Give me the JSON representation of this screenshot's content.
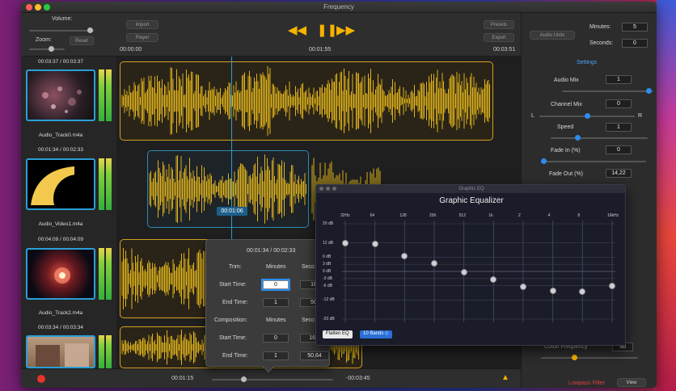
{
  "window": {
    "title": "Frequency"
  },
  "toolbar": {
    "volume_label": "Volume:",
    "zoom_label": "Zoom:",
    "reset_label": "Reset",
    "import_label": "Import",
    "player_label": "Player",
    "presets_label": "Presets",
    "export_label": "Export",
    "time_start": "00:00:00",
    "time_mid": "00:01:55",
    "time_end": "00:03:51",
    "rewind_glyph": "◀◀",
    "pause_glyph": "❚❚",
    "forward_glyph": "▶▶"
  },
  "right_panel": {
    "audio_units_label": "Audio Units",
    "minutes_label": "Minutes:",
    "minutes_value": "5",
    "seconds_label": "Seconds:",
    "seconds_value": "0",
    "settings_label": "Settings",
    "audio_mix_label": "Audio Mix",
    "audio_mix_value": "1",
    "channel_mix_label": "Channel Mix",
    "channel_mix_value": "0",
    "channel_left": "L",
    "channel_right": "R",
    "speed_label": "Speed",
    "speed_value": "1",
    "fade_in_label": "Fade In (%)",
    "fade_in_value": "0",
    "fade_out_label": "Fade Out (%)",
    "fade_out_value": "14,22",
    "cutoff_label": "Cutoff Frequency",
    "cutoff_value": "50",
    "lowpass_label": "Lowpass Filter",
    "view_label": "View"
  },
  "tracks": [
    {
      "time": "00:03:37 / 00:03:37",
      "name": "Audio_Track0.m4a"
    },
    {
      "time": "00:01:34 / 00:02:33",
      "name": "Audio_Video1.m4a"
    },
    {
      "time": "00:04:09 / 00:04:09",
      "name": "Audio_Track2.m4a"
    },
    {
      "time": "00:03:34 / 00:03:34",
      "name": ""
    }
  ],
  "timeline": {
    "playhead_time": "00:01:06"
  },
  "bottom": {
    "time_left": "00:01:15",
    "time_right": "-00:03:45",
    "warning_glyph": "▲"
  },
  "popover": {
    "header": "00:01:34 / 00:02:33",
    "trim_label": "Trim:",
    "minutes_col": "Minutes",
    "seconds_col": "Seco",
    "start_time_label": "Start Time:",
    "end_time_label": "End Time:",
    "trim_start_min": "0",
    "trim_start_sec": "16,",
    "trim_end_min": "1",
    "trim_end_sec": "50,",
    "composition_label": "Composition:",
    "minutes_col2": "Minutes",
    "seconds_col2": "Seco",
    "comp_start_min": "0",
    "comp_start_sec": "16,2",
    "comp_end_min": "1",
    "comp_end_sec": "50,64"
  },
  "equalizer": {
    "window_title": "Graphic EQ",
    "heading": "Graphic Equalizer",
    "frequencies": [
      "32Hz",
      "64",
      "128",
      "256",
      "512",
      "1k",
      "2",
      "4",
      "8",
      "16kHz"
    ],
    "db_labels": [
      "20 dB",
      "12 dB",
      "6 dB",
      "3 dB",
      "0 dB",
      "-3 dB",
      "-6 dB",
      "-12 dB",
      "-20 dB"
    ],
    "gains_db": [
      12,
      11.5,
      6.5,
      3.5,
      -0.5,
      -3.5,
      -6.5,
      -8,
      -8.5,
      -6
    ],
    "flatten_label": "Flatten EQ",
    "bands_label": "10 Bands ◇"
  },
  "colors": {
    "accent": "#f5b300",
    "waveform": "#f2c21b",
    "selection": "#2a9fd6",
    "record": "#e8352c"
  }
}
